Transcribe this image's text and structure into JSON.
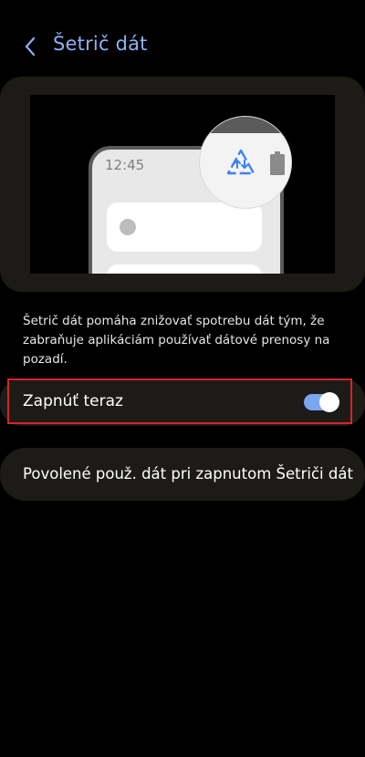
{
  "header": {
    "title": "Šetrič dát",
    "back_icon": "chevron-left-icon"
  },
  "illustration": {
    "phone_time": "12:45",
    "data_saver_icon": "data-saver-icon",
    "battery_icon": "battery-icon",
    "accent_color": "#3b82f6"
  },
  "description": "Šetrič dát pomáha znižovať spotrebu dát tým, že zabraňuje aplikáciám používať dátové prenosy na pozadí.",
  "toggle": {
    "label": "Zapnúť teraz",
    "state": "on",
    "track_color": "#7aa7ef"
  },
  "allowed_usage": {
    "label": "Povolené použ. dát pri zapnutom Šetriči dát"
  },
  "colors": {
    "title": "#8fb0f7",
    "card_bg": "#1d1b17",
    "highlight": "#d8222a"
  }
}
